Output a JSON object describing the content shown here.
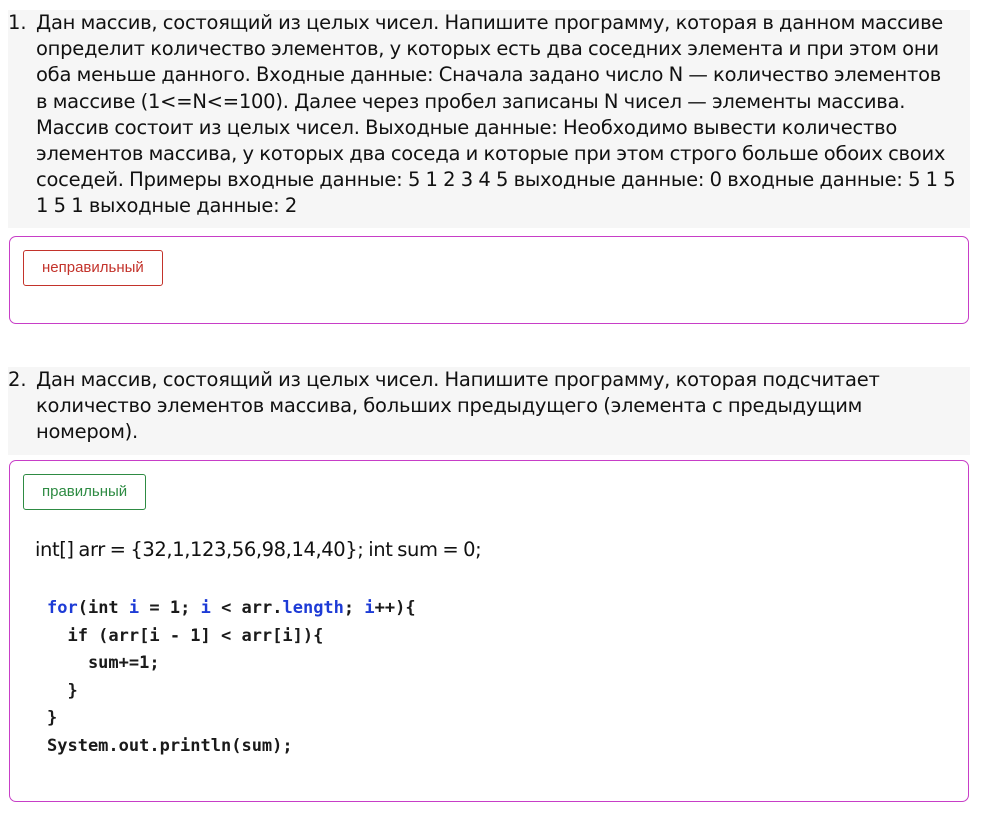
{
  "questions": [
    {
      "number": "1.",
      "text": "Дан массив, состоящий из целых чисел. Напишите программу, которая в данном массиве определит количество элементов, у которых есть два соседних элемента и при этом они оба меньше данного. Входные данные: Сначала задано число N — количество элементов в массиве (1<=N<=100). Далее через пробел записаны N чисел — элементы массива. Массив состоит из целых чисел. Выходные данные: Необходимо вывести количество элементов массива, у которых два соседа и которые при этом строго больше обоих своих соседей. Примеры входные данные: 5 1 2 3 4 5 выходные данные: 0 входные данные: 5 1 5 1 5 1 выходные данные: 2",
      "status": "неправильный",
      "status_color": "#c3332b"
    },
    {
      "number": "2.",
      "text": "Дан массив, состоящий из целых чисел. Напишите программу, которая подсчитает количество элементов массива, больших предыдущего (элемента с предыдущим номером).",
      "status": "правильный",
      "status_color": "#2e8b43",
      "answer_intro": "int[] arr = {32,1,123,56,98,14,40}; int sum = 0;",
      "code": {
        "line1": {
          "for": "for",
          "a": "(int ",
          "i1": "i",
          "b": " = 1; ",
          "i2": "i",
          "c": " < arr.",
          "length": "length",
          "d": "; ",
          "i3": "i",
          "e": "++){"
        },
        "line2": "  if (arr[i - 1] < arr[i]){",
        "line3": "    sum+=1;",
        "line4": "  }",
        "line5": "}",
        "line6": "System.out.println(sum);"
      }
    }
  ],
  "colors": {
    "card_border": "#c73ec7",
    "keyword": "#1d3bd6",
    "question_bg": "#f6f6f6"
  }
}
